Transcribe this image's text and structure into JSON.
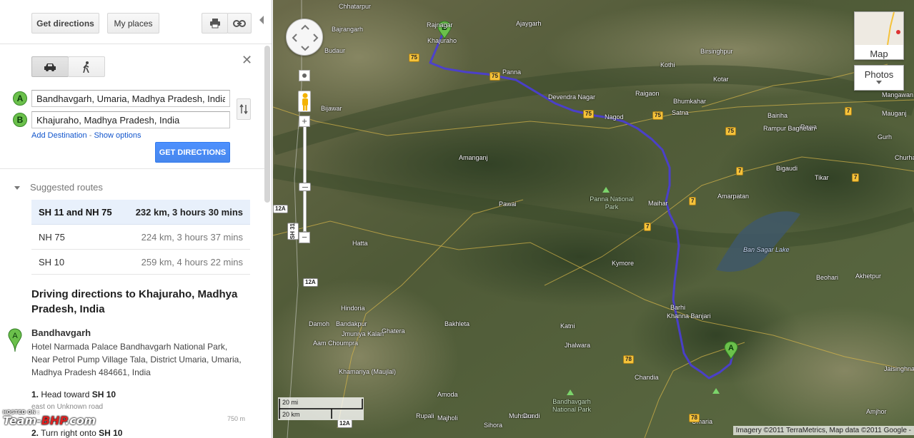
{
  "toolbar": {
    "get_directions": "Get directions",
    "my_places": "My places",
    "print_icon": "printer-icon",
    "link_icon": "link-icon"
  },
  "directions_form": {
    "modes": [
      "car-icon",
      "walk-icon"
    ],
    "selected_mode": "car-icon",
    "waypoint_a": {
      "marker": "A",
      "value": "Bandhavgarh, Umaria, Madhya Pradesh, India"
    },
    "waypoint_b": {
      "marker": "B",
      "value": "Khajuraho, Madhya Pradesh, India"
    },
    "add_destination": "Add Destination",
    "separator": "-",
    "show_options": "Show options",
    "submit": "GET DIRECTIONS"
  },
  "suggested": {
    "heading": "Suggested routes",
    "routes": [
      {
        "name": "SH 11 and NH 75",
        "detail": "232 km, 3 hours 30 mins",
        "selected": true
      },
      {
        "name": "NH 75",
        "detail": "224 km, 3 hours 37 mins",
        "selected": false
      },
      {
        "name": "SH 10",
        "detail": "259 km, 4 hours 22 mins",
        "selected": false
      }
    ]
  },
  "driving": {
    "title": "Driving directions to Khajuraho, Madhya Pradesh, India",
    "start_marker": "A",
    "start_name": "Bandhavgarh",
    "start_address": "Hotel Narmada Palace Bandhavgarh National Park, Near Petrol Pump Village Tala, District Umaria, Umaria, Madhya Pradesh 484661, India",
    "steps": [
      {
        "num": "1.",
        "text": "Head toward",
        "road": "SH 10",
        "sub": "east on Unknown road",
        "dist": "750 m"
      },
      {
        "num": "2.",
        "text": "Turn right onto",
        "road": "SH 10"
      }
    ]
  },
  "watermark": {
    "hosted": "HOSTED ON :",
    "brand_a": "Team-",
    "brand_b": "BHP",
    "brand_c": ".com"
  },
  "map": {
    "type_button": "Map",
    "photos_button": "Photos",
    "scale_mi": "20 mi",
    "scale_km": "20 km",
    "copyright": "Imagery ©2011 TerraMetrics, Map data ©2011 Google -",
    "marker_a": "A",
    "marker_b": "B",
    "route_color": "#4a3dd8",
    "places": [
      {
        "t": "Chhatarpur"
      },
      {
        "t": "Bajrangarh"
      },
      {
        "t": "Budaur"
      },
      {
        "t": "Rajnagar"
      },
      {
        "t": "Khajuraho"
      },
      {
        "t": "Ajaygarh"
      },
      {
        "t": "Panna"
      },
      {
        "t": "Devendra Nagar"
      },
      {
        "t": "Nagod"
      },
      {
        "t": "Satna"
      },
      {
        "t": "Bijawar"
      },
      {
        "t": "Amanganj"
      },
      {
        "t": "Pawai"
      },
      {
        "t": "Hatta"
      },
      {
        "t": "Hindoria"
      },
      {
        "t": "Damoh"
      },
      {
        "t": "Bandakpur"
      },
      {
        "t": "Jmuniya Kalan"
      },
      {
        "t": "Aam Choumpra"
      },
      {
        "t": "Ghatera"
      },
      {
        "t": "Bakhleta"
      },
      {
        "t": "Katni"
      },
      {
        "t": "Jhalwara"
      },
      {
        "t": "Khamariya (Maujlal)"
      },
      {
        "t": "Amoda"
      },
      {
        "t": "Majholi"
      },
      {
        "t": "Rupali"
      },
      {
        "t": "Muhsam"
      },
      {
        "t": "Dundi"
      },
      {
        "t": "Sihora"
      },
      {
        "t": "Kymore"
      },
      {
        "t": "Maihar"
      },
      {
        "t": "Barhi"
      },
      {
        "t": "Khanna Banjari"
      },
      {
        "t": "Chandia"
      },
      {
        "t": "Umaria"
      },
      {
        "t": "Amarpatan"
      },
      {
        "t": "Bigaudi"
      },
      {
        "t": "Rewa"
      },
      {
        "t": "Tikar"
      },
      {
        "t": "Churhat"
      },
      {
        "t": "Rampur Baghelan"
      },
      {
        "t": "Bairiha"
      },
      {
        "t": "Gurh"
      },
      {
        "t": "Mangawan"
      },
      {
        "t": "Mauganj"
      },
      {
        "t": "Birsinghpur"
      },
      {
        "t": "Kothi"
      },
      {
        "t": "Raigaon"
      },
      {
        "t": "Bhumkahar"
      },
      {
        "t": "Kotar"
      },
      {
        "t": "Beohari"
      },
      {
        "t": "Akhetpur"
      },
      {
        "t": "Jaisinghnagar"
      },
      {
        "t": "Amjhor"
      },
      {
        "t": "Bakhleta"
      },
      {
        "t": "Damoh"
      }
    ],
    "lake": "Ban Sagar Lake",
    "parks": [
      "Panna National Park",
      "Bandhavgarh National Park"
    ]
  }
}
